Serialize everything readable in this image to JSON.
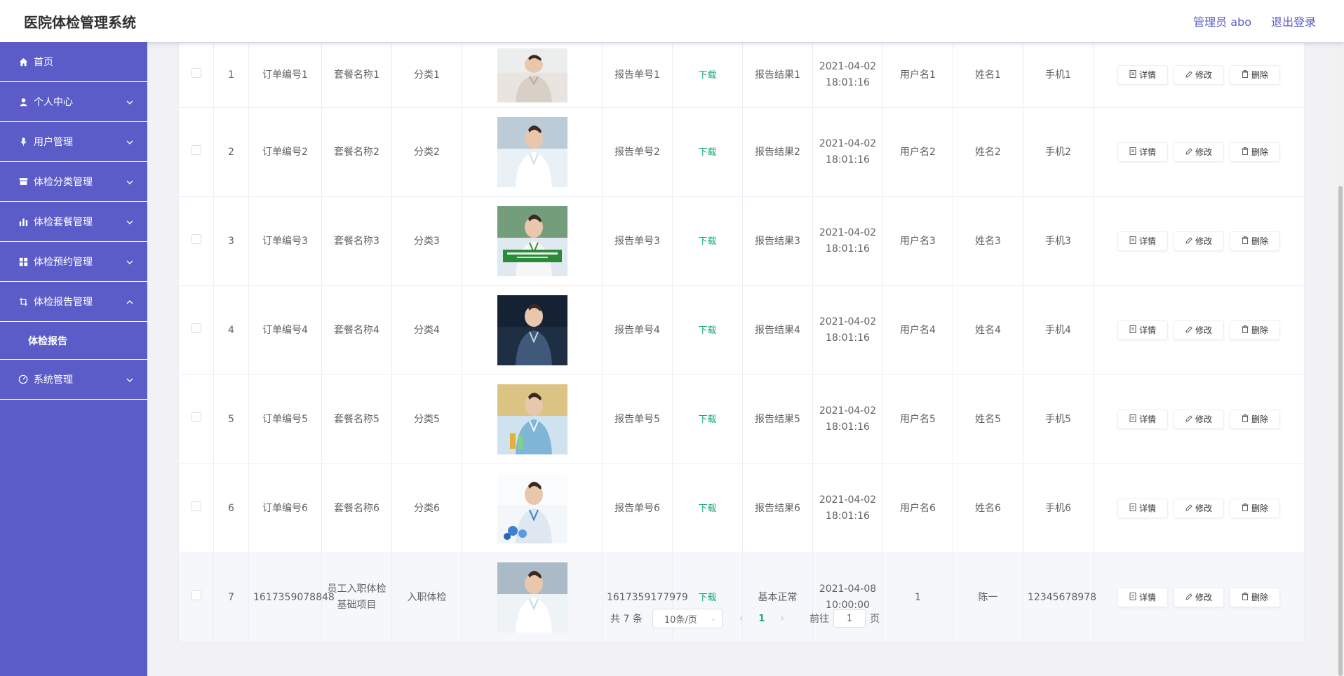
{
  "header": {
    "title": "医院体检管理系统",
    "user_label": "管理员 abo",
    "logout_label": "退出登录"
  },
  "sidebar": {
    "items": [
      {
        "label": "首页",
        "icon": "home-icon",
        "expandable": false
      },
      {
        "label": "个人中心",
        "icon": "user-icon",
        "expandable": true
      },
      {
        "label": "用户管理",
        "icon": "microphone-icon",
        "expandable": true
      },
      {
        "label": "体检分类管理",
        "icon": "folder-icon",
        "expandable": true
      },
      {
        "label": "体检套餐管理",
        "icon": "bar-chart-icon",
        "expandable": true
      },
      {
        "label": "体检预约管理",
        "icon": "grid-icon",
        "expandable": true
      },
      {
        "label": "体检报告管理",
        "icon": "crop-icon",
        "expandable": true,
        "expanded": true
      },
      {
        "label": "体检报告",
        "icon": "",
        "sub": true
      },
      {
        "label": "系统管理",
        "icon": "dashboard-icon",
        "expandable": true
      }
    ]
  },
  "table": {
    "download_label": "下载",
    "actions": {
      "detail": "详情",
      "edit": "修改",
      "delete": "删除"
    },
    "rows": [
      {
        "index": "1",
        "order_no": "订单编号1",
        "package": "套餐名称1",
        "category": "分类1",
        "report_no": "报告单号1",
        "result": "报告结果1",
        "time": "2021-04-02 18:01:16",
        "username": "用户名1",
        "name": "姓名1",
        "phone": "手机1"
      },
      {
        "index": "2",
        "order_no": "订单编号2",
        "package": "套餐名称2",
        "category": "分类2",
        "report_no": "报告单号2",
        "result": "报告结果2",
        "time": "2021-04-02 18:01:16",
        "username": "用户名2",
        "name": "姓名2",
        "phone": "手机2"
      },
      {
        "index": "3",
        "order_no": "订单编号3",
        "package": "套餐名称3",
        "category": "分类3",
        "report_no": "报告单号3",
        "result": "报告结果3",
        "time": "2021-04-02 18:01:16",
        "username": "用户名3",
        "name": "姓名3",
        "phone": "手机3"
      },
      {
        "index": "4",
        "order_no": "订单编号4",
        "package": "套餐名称4",
        "category": "分类4",
        "report_no": "报告单号4",
        "result": "报告结果4",
        "time": "2021-04-02 18:01:16",
        "username": "用户名4",
        "name": "姓名4",
        "phone": "手机4"
      },
      {
        "index": "5",
        "order_no": "订单编号5",
        "package": "套餐名称5",
        "category": "分类5",
        "report_no": "报告单号5",
        "result": "报告结果5",
        "time": "2021-04-02 18:01:16",
        "username": "用户名5",
        "name": "姓名5",
        "phone": "手机5"
      },
      {
        "index": "6",
        "order_no": "订单编号6",
        "package": "套餐名称6",
        "category": "分类6",
        "report_no": "报告单号6",
        "result": "报告结果6",
        "time": "2021-04-02 18:01:16",
        "username": "用户名6",
        "name": "姓名6",
        "phone": "手机6"
      },
      {
        "index": "7",
        "order_no": "1617359078848",
        "package": "员工入职体检基础项目",
        "category": "入职体检",
        "report_no": "1617359177979",
        "result": "基本正常",
        "time": "2021-04-08 10:00:00",
        "username": "1",
        "name": "陈一",
        "phone": "12345678978"
      }
    ]
  },
  "pagination": {
    "total": "共 7 条",
    "page_size": "10条/页",
    "current_page": "1",
    "goto_label": "前往",
    "goto_value": "1",
    "page_suffix": "页"
  },
  "colors": {
    "sidebar_bg": "#5c5cc9",
    "accent": "#19a974",
    "header_text": "#5a5ec6"
  }
}
